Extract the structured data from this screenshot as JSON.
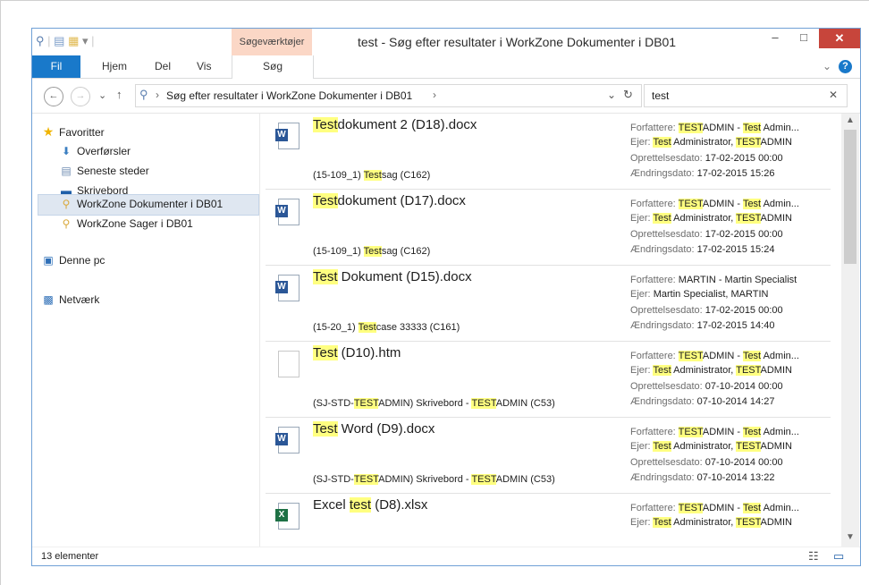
{
  "window": {
    "title": "test - Søg efter resultater i WorkZone Dokumenter i DB01",
    "context_tab": "Søgeværktøjer",
    "controls": {
      "minimize": "–",
      "maximize": "□",
      "close": "✕"
    }
  },
  "ribbon": {
    "tabs": [
      "Fil",
      "Hjem",
      "Del",
      "Vis",
      "Søg"
    ],
    "collapse": "⌄",
    "help": "?"
  },
  "address": {
    "back": "←",
    "forward": "→",
    "recent": "⌄",
    "up": "↑",
    "path": "Søg efter resultater i WorkZone Dokumenter i DB01",
    "path_sep": "›",
    "dropdown": "⌄",
    "refresh": "↻",
    "search_value": "test",
    "search_clear": "✕"
  },
  "nav": {
    "favorites_label": "Favoritter",
    "favorites": [
      {
        "label": "Overførsler",
        "icon": "downloads-icon"
      },
      {
        "label": "Seneste steder",
        "icon": "recent-places-icon"
      },
      {
        "label": "Skrivebord",
        "icon": "desktop-icon"
      },
      {
        "label": "WorkZone Dokumenter i DB01",
        "icon": "search-folder-icon"
      },
      {
        "label": "WorkZone Sager i DB01",
        "icon": "search-folder-icon"
      }
    ],
    "this_pc": "Denne pc",
    "network": "Netværk"
  },
  "labels": {
    "author": "Forfattere:",
    "owner": "Ejer:",
    "created": "Oprettelsesdato:",
    "modified": "Ændringsdato:"
  },
  "results": [
    {
      "type": "word",
      "name": [
        {
          "t": "Test",
          "h": true
        },
        {
          "t": "dokument 2 (D18).docx",
          "h": false
        }
      ],
      "sub": [
        {
          "t": "(15-109_1) ",
          "h": false
        },
        {
          "t": "Test",
          "h": true
        },
        {
          "t": "sag (C162)",
          "h": false
        }
      ],
      "author": [
        {
          "t": "TEST",
          "h": true
        },
        {
          "t": "ADMIN - ",
          "h": false
        },
        {
          "t": "Test",
          "h": true
        },
        {
          "t": " Admin...",
          "h": false
        }
      ],
      "owner": [
        {
          "t": "Test",
          "h": true
        },
        {
          "t": " Administrator, ",
          "h": false
        },
        {
          "t": "TEST",
          "h": true
        },
        {
          "t": "ADMIN",
          "h": false
        }
      ],
      "created": "17-02-2015 00:00",
      "modified": "17-02-2015 15:26"
    },
    {
      "type": "word",
      "name": [
        {
          "t": "Test",
          "h": true
        },
        {
          "t": "dokument (D17).docx",
          "h": false
        }
      ],
      "sub": [
        {
          "t": "(15-109_1) ",
          "h": false
        },
        {
          "t": "Test",
          "h": true
        },
        {
          "t": "sag (C162)",
          "h": false
        }
      ],
      "author": [
        {
          "t": "TEST",
          "h": true
        },
        {
          "t": "ADMIN - ",
          "h": false
        },
        {
          "t": "Test",
          "h": true
        },
        {
          "t": " Admin...",
          "h": false
        }
      ],
      "owner": [
        {
          "t": "Test",
          "h": true
        },
        {
          "t": " Administrator, ",
          "h": false
        },
        {
          "t": "TEST",
          "h": true
        },
        {
          "t": "ADMIN",
          "h": false
        }
      ],
      "created": "17-02-2015 00:00",
      "modified": "17-02-2015 15:24"
    },
    {
      "type": "word",
      "name": [
        {
          "t": "Test",
          "h": true
        },
        {
          "t": " Dokument (D15).docx",
          "h": false
        }
      ],
      "sub": [
        {
          "t": "(15-20_1) ",
          "h": false
        },
        {
          "t": "Test",
          "h": true
        },
        {
          "t": "case 33333 (C161)",
          "h": false
        }
      ],
      "author": [
        {
          "t": "MARTIN - Martin Specialist",
          "h": false
        }
      ],
      "owner": [
        {
          "t": "Martin Specialist, MARTIN",
          "h": false
        }
      ],
      "created": "17-02-2015 00:00",
      "modified": "17-02-2015 14:40"
    },
    {
      "type": "htm",
      "name": [
        {
          "t": "Test",
          "h": true
        },
        {
          "t": " (D10).htm",
          "h": false
        }
      ],
      "sub": [
        {
          "t": "(SJ-STD-",
          "h": false
        },
        {
          "t": "TEST",
          "h": true
        },
        {
          "t": "ADMIN) Skrivebord - ",
          "h": false
        },
        {
          "t": "TEST",
          "h": true
        },
        {
          "t": "ADMIN (C53)",
          "h": false
        }
      ],
      "author": [
        {
          "t": "TEST",
          "h": true
        },
        {
          "t": "ADMIN - ",
          "h": false
        },
        {
          "t": "Test",
          "h": true
        },
        {
          "t": " Admin...",
          "h": false
        }
      ],
      "owner": [
        {
          "t": "Test",
          "h": true
        },
        {
          "t": " Administrator, ",
          "h": false
        },
        {
          "t": "TEST",
          "h": true
        },
        {
          "t": "ADMIN",
          "h": false
        }
      ],
      "created": "07-10-2014 00:00",
      "modified": "07-10-2014 14:27"
    },
    {
      "type": "word",
      "name": [
        {
          "t": "Test",
          "h": true
        },
        {
          "t": " Word (D9).docx",
          "h": false
        }
      ],
      "sub": [
        {
          "t": "(SJ-STD-",
          "h": false
        },
        {
          "t": "TEST",
          "h": true
        },
        {
          "t": "ADMIN) Skrivebord - ",
          "h": false
        },
        {
          "t": "TEST",
          "h": true
        },
        {
          "t": "ADMIN (C53)",
          "h": false
        }
      ],
      "author": [
        {
          "t": "TEST",
          "h": true
        },
        {
          "t": "ADMIN - ",
          "h": false
        },
        {
          "t": "Test",
          "h": true
        },
        {
          "t": " Admin...",
          "h": false
        }
      ],
      "owner": [
        {
          "t": "Test",
          "h": true
        },
        {
          "t": " Administrator, ",
          "h": false
        },
        {
          "t": "TEST",
          "h": true
        },
        {
          "t": "ADMIN",
          "h": false
        }
      ],
      "created": "07-10-2014 00:00",
      "modified": "07-10-2014 13:22"
    },
    {
      "type": "excel",
      "name": [
        {
          "t": "Excel ",
          "h": false
        },
        {
          "t": "test",
          "h": true
        },
        {
          "t": " (D8).xlsx",
          "h": false
        }
      ],
      "sub": [],
      "author": [
        {
          "t": "TEST",
          "h": true
        },
        {
          "t": "ADMIN - ",
          "h": false
        },
        {
          "t": "Test",
          "h": true
        },
        {
          "t": " Admin...",
          "h": false
        }
      ],
      "owner": [
        {
          "t": "Test",
          "h": true
        },
        {
          "t": " Administrator, ",
          "h": false
        },
        {
          "t": "TEST",
          "h": true
        },
        {
          "t": "ADMIN",
          "h": false
        }
      ],
      "created": "",
      "modified": ""
    }
  ],
  "status": {
    "count": "13 elementer",
    "details_view": "☷",
    "tiles_view": "▭"
  },
  "colors": {
    "highlight": "#ffff80",
    "file_tab": "#1979ca",
    "context_tab": "#fbd7c6",
    "close_button": "#c7453b",
    "nav_selected": "#dfe7f1"
  }
}
